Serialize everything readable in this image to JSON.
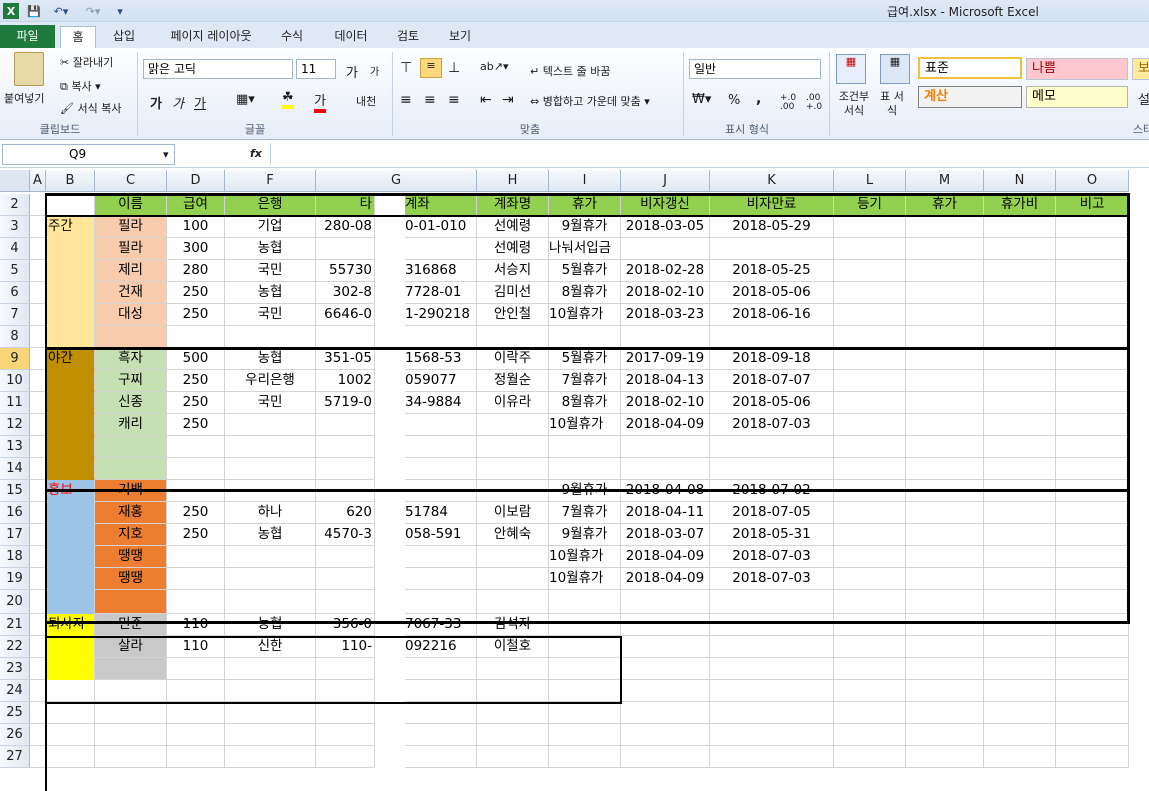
{
  "window": {
    "title": "급여.xlsx - Microsoft Excel"
  },
  "quick_access": [
    "save-icon",
    "undo-icon",
    "redo-icon",
    "customize-icon"
  ],
  "tabs": [
    "파일",
    "홈",
    "삽입",
    "페이지 레이아웃",
    "수식",
    "데이터",
    "검토",
    "보기"
  ],
  "ribbon": {
    "clipboard": {
      "paste": "붙여넣기",
      "cut": "잘라내기",
      "copy": "복사",
      "format_painter": "서식 복사",
      "label": "클립보드"
    },
    "font": {
      "name": "맑은 고딕",
      "size": "11",
      "label": "글꼴",
      "bold": "가",
      "italic": "가",
      "underline": "가",
      "fontcolor": "가",
      "grow": "가",
      "shrink": "가",
      "phonetic": "내천"
    },
    "alignment": {
      "wrap": "텍스트 줄 바꿈",
      "merge": "병합하고 가운데 맞춤",
      "label": "맞춤"
    },
    "number": {
      "format": "일반",
      "percent": "%",
      "comma": ",",
      "inc": "+.0 .00",
      "dec": ".00 +.0",
      "label": "표시 형식"
    },
    "styles": {
      "conditional": "조건부 서식",
      "table": "표 서식",
      "normal": "표준",
      "bad": "나쁨",
      "good": "보",
      "calc": "계산",
      "memo": "메모",
      "more": "설",
      "label": "스타"
    }
  },
  "formula_bar": {
    "name_box": "Q9",
    "fx": "fx",
    "value": ""
  },
  "columns": [
    "A",
    "B",
    "C",
    "D",
    "F",
    "G",
    "H",
    "I",
    "J",
    "K",
    "L",
    "M",
    "N",
    "O"
  ],
  "rows": [
    "2",
    "3",
    "4",
    "5",
    "6",
    "7",
    "8",
    "9",
    "10",
    "11",
    "12",
    "13",
    "14",
    "15",
    "16",
    "17",
    "18",
    "19",
    "20",
    "21",
    "22",
    "23",
    "24",
    "25",
    "26",
    "27"
  ],
  "selected": {
    "column": "Q",
    "row": "9"
  },
  "colors": {
    "header_green": "#92d050",
    "day": "#ffe699",
    "day_name": "#f8cbad",
    "night": "#bf8f00",
    "night_name": "#c6e0b4",
    "pr": "#9dc3e6",
    "pr_name": "#ed7d31",
    "retired": "#ffff00",
    "retired_name": "#c9c9c9",
    "red_text": "#ff0000"
  },
  "sheet": {
    "headers": [
      "이름",
      "급여",
      "은행",
      "타",
      "계좌",
      "계좌명",
      "휴가",
      "비자갱신",
      "비자만료",
      "등기",
      "휴가",
      "휴가비",
      "비고"
    ],
    "groups": [
      {
        "label": "주간"
      },
      {
        "label": "야간"
      },
      {
        "label": "홍보"
      },
      {
        "label": "퇴사자"
      }
    ],
    "rows": [
      [
        "필라",
        "100",
        "기업",
        "280-08",
        "0-01-010",
        "선예령",
        "9월휴가",
        "2018-03-05",
        "2018-05-29"
      ],
      [
        "필라",
        "300",
        "농협",
        "",
        "",
        "선예령",
        "나눠서입금",
        "",
        ""
      ],
      [
        "제리",
        "280",
        "국민",
        "55730",
        "316868",
        "서승지",
        "5월휴가",
        "2018-02-28",
        "2018-05-25"
      ],
      [
        "건재",
        "250",
        "농협",
        "302-8",
        "7728-01",
        "김미선",
        "8월휴가",
        "2018-02-10",
        "2018-05-06"
      ],
      [
        "대성",
        "250",
        "국민",
        "6646-0",
        "1-290218",
        "안인철",
        "10월휴가",
        "2018-03-23",
        "2018-06-16"
      ],
      [
        "",
        "",
        "",
        "",
        "",
        "",
        "",
        "",
        ""
      ],
      [
        "흑자",
        "500",
        "농협",
        "351-05",
        "1568-53",
        "이락주",
        "5월휴가",
        "2017-09-19",
        "2018-09-18"
      ],
      [
        "구찌",
        "250",
        "우리은행",
        "1002",
        "059077",
        "정월순",
        "7월휴가",
        "2018-04-13",
        "2018-07-07"
      ],
      [
        "신종",
        "250",
        "국민",
        "5719-0",
        "34-9884",
        "이유라",
        "8월휴가",
        "2018-02-10",
        "2018-05-06"
      ],
      [
        "캐리",
        "250",
        "",
        "",
        "",
        "",
        "10월휴가",
        "2018-04-09",
        "2018-07-03"
      ],
      [
        "",
        "",
        "",
        "",
        "",
        "",
        "",
        "",
        ""
      ],
      [
        "",
        "",
        "",
        "",
        "",
        "",
        "",
        "",
        ""
      ],
      [
        "기백",
        "",
        "",
        "",
        "",
        "",
        "9월휴가",
        "2018-04-08",
        "2018-07-02"
      ],
      [
        "재홍",
        "250",
        "하나",
        "620",
        "51784",
        "이보람",
        "7월휴가",
        "2018-04-11",
        "2018-07-05"
      ],
      [
        "지호",
        "250",
        "농협",
        "4570-3",
        "058-591",
        "안혜숙",
        "9월휴가",
        "2018-03-07",
        "2018-05-31"
      ],
      [
        "땡땡",
        "",
        "",
        "",
        "",
        "",
        "10월휴가",
        "2018-04-09",
        "2018-07-03"
      ],
      [
        "땡땡",
        "",
        "",
        "",
        "",
        "",
        "10월휴가",
        "2018-04-09",
        "2018-07-03"
      ],
      [
        "",
        "",
        "",
        "",
        "",
        "",
        "",
        "",
        ""
      ],
      [
        "민준",
        "110",
        "농협",
        "356-0",
        "7067-33",
        "김석자",
        "",
        "",
        ""
      ],
      [
        "살라",
        "110",
        "신한",
        "110-",
        "092216",
        "이철호",
        "",
        "",
        ""
      ],
      [
        "",
        "",
        "",
        "",
        "",
        "",
        "",
        "",
        ""
      ]
    ]
  }
}
